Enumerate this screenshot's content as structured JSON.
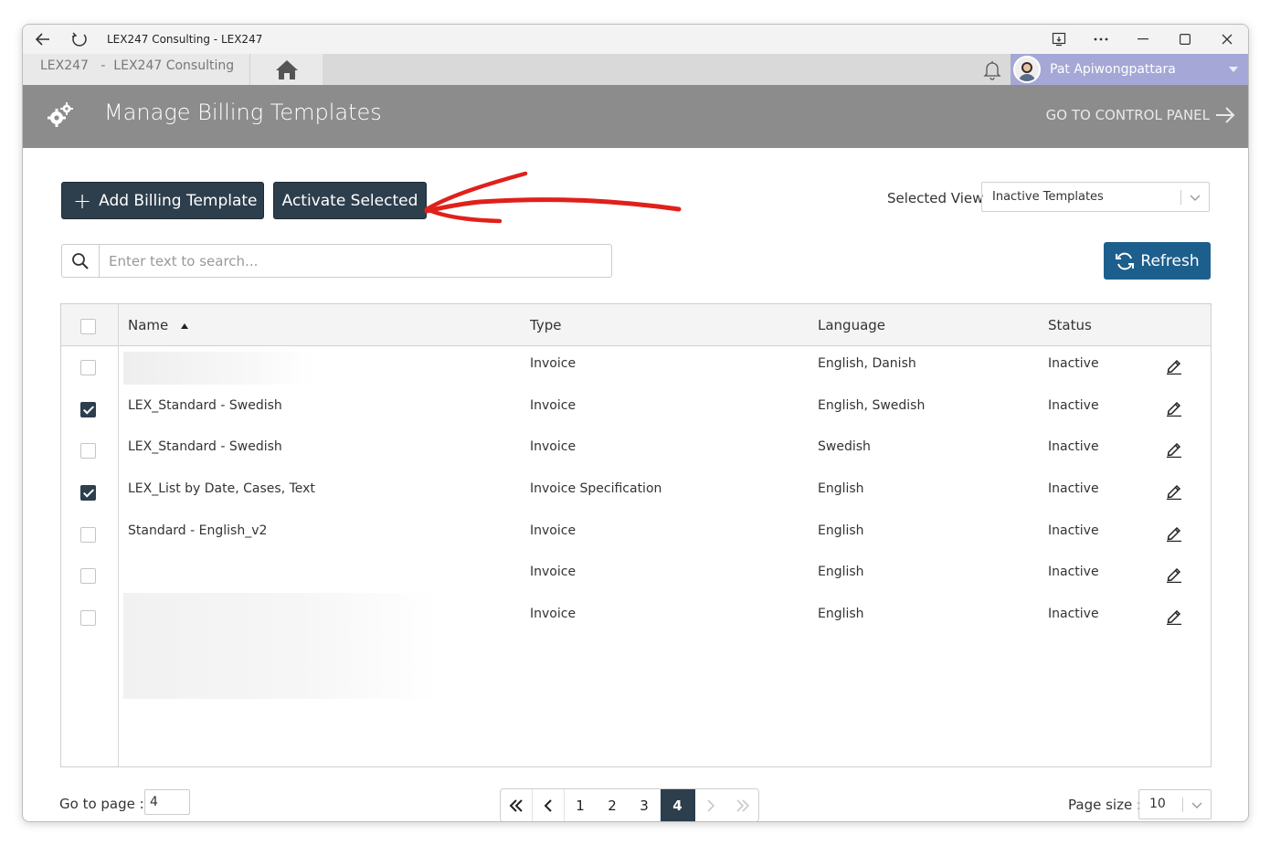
{
  "browser": {
    "tab_title": "LEX247 Consulting - LEX247"
  },
  "appbar": {
    "brand": "LEX247",
    "separator": "-",
    "firm": "LEX247 Consulting",
    "user_name": "Pat Apiwongpattara"
  },
  "header": {
    "title": "Manage Billing Templates",
    "control_panel_link": "GO TO CONTROL PANEL"
  },
  "toolbar": {
    "add_label": "Add Billing Template",
    "activate_label": "Activate Selected",
    "selected_view_label": "Selected View",
    "selected_view_value": "Inactive Templates",
    "refresh_label": "Refresh",
    "annotation_arrow_color": "#e0201b"
  },
  "search": {
    "placeholder": "Enter text to search..."
  },
  "grid": {
    "columns": {
      "name": "Name",
      "type": "Type",
      "language": "Language",
      "status": "Status"
    },
    "rows": [
      {
        "name": "",
        "type": "Invoice",
        "language": "English, Danish",
        "status": "Inactive",
        "checked": false
      },
      {
        "name": "LEX_Standard - Swedish",
        "type": "Invoice",
        "language": "English, Swedish",
        "status": "Inactive",
        "checked": true
      },
      {
        "name": "LEX_Standard - Swedish",
        "type": "Invoice",
        "language": "Swedish",
        "status": "Inactive",
        "checked": false
      },
      {
        "name": "LEX_List by Date, Cases, Text",
        "type": "Invoice Specification",
        "language": "English",
        "status": "Inactive",
        "checked": true
      },
      {
        "name": "Standard - English_v2",
        "type": "Invoice",
        "language": "English",
        "status": "Inactive",
        "checked": false
      },
      {
        "name": "",
        "type": "Invoice",
        "language": "English",
        "status": "Inactive",
        "checked": false
      },
      {
        "name": "",
        "type": "Invoice",
        "language": "English",
        "status": "Inactive",
        "checked": false
      }
    ]
  },
  "pagination": {
    "goto_label": "Go to page :",
    "goto_value": "4",
    "pages": [
      "1",
      "2",
      "3",
      "4"
    ],
    "current_page": "4",
    "page_size_label": "Page size :",
    "page_size_value": "10"
  }
}
